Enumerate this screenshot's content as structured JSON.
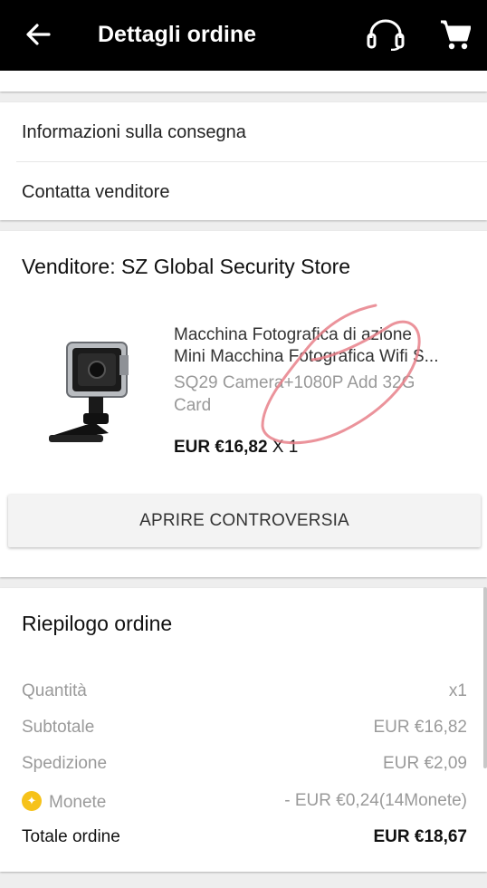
{
  "header": {
    "title": "Dettagli ordine",
    "back_icon": "arrow-left-icon",
    "support_icon": "headset-icon",
    "cart_icon": "cart-icon"
  },
  "links": {
    "delivery_info": "Informazioni sulla consegna",
    "contact_seller": "Contatta venditore"
  },
  "order": {
    "seller": "Venditore: SZ Global Security Store",
    "product": {
      "name_line1": "Macchina Fotografica di azione",
      "name_line2": "Mini Macchina Fotografica Wifi S...",
      "variant": "SQ29 Camera+1080P Add 32G Card",
      "price": "EUR €16,82",
      "qty": "X 1"
    },
    "dispute_button": "APRIRE CONTROVERSIA"
  },
  "summary": {
    "title": "Riepilogo ordine",
    "rows": [
      {
        "label": "Quantità",
        "value": "x1"
      },
      {
        "label": "Subtotale",
        "value": "EUR €16,82"
      },
      {
        "label": "Spedizione",
        "value": "EUR €2,09"
      },
      {
        "label": "Monete",
        "value": "- EUR €0,24(14Monete)"
      }
    ],
    "total_label": "Totale ordine",
    "total_value": "EUR €18,67"
  },
  "colors": {
    "header_bg": "#000000",
    "coin": "#f6c21a",
    "annotation": "#e8808a"
  }
}
